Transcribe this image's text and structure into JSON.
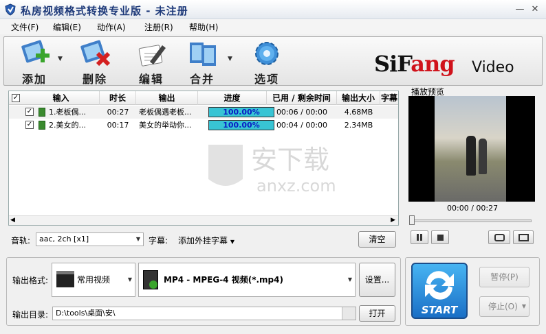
{
  "window": {
    "title": "私房视频格式转换专业版  - 未注册",
    "min_label": "—",
    "close_label": "✕"
  },
  "menu": [
    "文件(F)",
    "编辑(E)",
    "动作(A)",
    "注册(R)",
    "帮助(H)"
  ],
  "toolbar": {
    "add": "添加",
    "delete": "删除",
    "edit": "编辑",
    "merge": "合并",
    "options": "选项",
    "brand_a": "SiF",
    "brand_b": "ang",
    "brand_c": "Video"
  },
  "table": {
    "headers": [
      "输入",
      "时长",
      "输出",
      "进度",
      "已用 / 剩余时间",
      "输出大小",
      "字幕"
    ],
    "rows": [
      {
        "input": "1.老板偶...",
        "duration": "00:27",
        "output": "老板偶遇老板...",
        "progress": "100.00%",
        "time": "00:06 / 00:00",
        "size": "4.68MB"
      },
      {
        "input": "2.美女的...",
        "duration": "00:17",
        "output": "美女的举动你...",
        "progress": "100.00%",
        "time": "00:04 / 00:00",
        "size": "2.34MB"
      }
    ]
  },
  "preview": {
    "label": "播放预览",
    "time": "00:00 / 00:27"
  },
  "audio": {
    "label": "音轨:",
    "value": "aac, 2ch [x1]",
    "subtitle_label": "字幕:",
    "subtitle_value": "添加外挂字幕",
    "clear": "清空"
  },
  "output": {
    "format_label": "输出格式:",
    "category": "常用视频",
    "format": "MP4 - MPEG-4 视频(*.mp4)",
    "settings": "设置...",
    "dir_label": "输出目录:",
    "dir_value": "D:\\tools\\桌面\\安\\",
    "open": "打开"
  },
  "controls": {
    "start": "START",
    "pause": "暂停(P)",
    "stop": "停止(O)"
  },
  "watermark": {
    "cn": "安下载",
    "en": "anxz.com"
  },
  "colors": {
    "progress": "#38c4d4",
    "progress_text": "#0a1cc4",
    "brand_red": "#d0121b",
    "start_blue": "#1a6fc6"
  }
}
